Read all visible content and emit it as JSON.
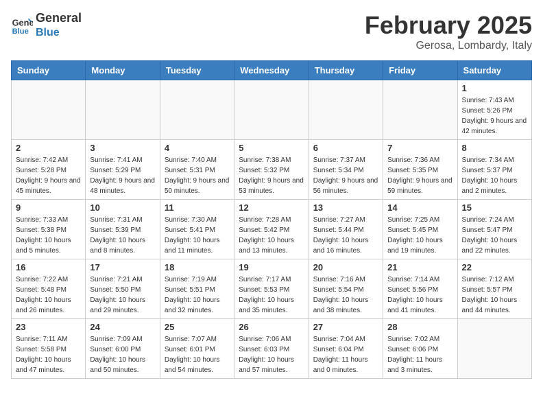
{
  "logo": {
    "text_general": "General",
    "text_blue": "Blue"
  },
  "header": {
    "month": "February 2025",
    "location": "Gerosa, Lombardy, Italy"
  },
  "days_of_week": [
    "Sunday",
    "Monday",
    "Tuesday",
    "Wednesday",
    "Thursday",
    "Friday",
    "Saturday"
  ],
  "weeks": [
    [
      {
        "day": "",
        "info": ""
      },
      {
        "day": "",
        "info": ""
      },
      {
        "day": "",
        "info": ""
      },
      {
        "day": "",
        "info": ""
      },
      {
        "day": "",
        "info": ""
      },
      {
        "day": "",
        "info": ""
      },
      {
        "day": "1",
        "info": "Sunrise: 7:43 AM\nSunset: 5:26 PM\nDaylight: 9 hours and 42 minutes."
      }
    ],
    [
      {
        "day": "2",
        "info": "Sunrise: 7:42 AM\nSunset: 5:28 PM\nDaylight: 9 hours and 45 minutes."
      },
      {
        "day": "3",
        "info": "Sunrise: 7:41 AM\nSunset: 5:29 PM\nDaylight: 9 hours and 48 minutes."
      },
      {
        "day": "4",
        "info": "Sunrise: 7:40 AM\nSunset: 5:31 PM\nDaylight: 9 hours and 50 minutes."
      },
      {
        "day": "5",
        "info": "Sunrise: 7:38 AM\nSunset: 5:32 PM\nDaylight: 9 hours and 53 minutes."
      },
      {
        "day": "6",
        "info": "Sunrise: 7:37 AM\nSunset: 5:34 PM\nDaylight: 9 hours and 56 minutes."
      },
      {
        "day": "7",
        "info": "Sunrise: 7:36 AM\nSunset: 5:35 PM\nDaylight: 9 hours and 59 minutes."
      },
      {
        "day": "8",
        "info": "Sunrise: 7:34 AM\nSunset: 5:37 PM\nDaylight: 10 hours and 2 minutes."
      }
    ],
    [
      {
        "day": "9",
        "info": "Sunrise: 7:33 AM\nSunset: 5:38 PM\nDaylight: 10 hours and 5 minutes."
      },
      {
        "day": "10",
        "info": "Sunrise: 7:31 AM\nSunset: 5:39 PM\nDaylight: 10 hours and 8 minutes."
      },
      {
        "day": "11",
        "info": "Sunrise: 7:30 AM\nSunset: 5:41 PM\nDaylight: 10 hours and 11 minutes."
      },
      {
        "day": "12",
        "info": "Sunrise: 7:28 AM\nSunset: 5:42 PM\nDaylight: 10 hours and 13 minutes."
      },
      {
        "day": "13",
        "info": "Sunrise: 7:27 AM\nSunset: 5:44 PM\nDaylight: 10 hours and 16 minutes."
      },
      {
        "day": "14",
        "info": "Sunrise: 7:25 AM\nSunset: 5:45 PM\nDaylight: 10 hours and 19 minutes."
      },
      {
        "day": "15",
        "info": "Sunrise: 7:24 AM\nSunset: 5:47 PM\nDaylight: 10 hours and 22 minutes."
      }
    ],
    [
      {
        "day": "16",
        "info": "Sunrise: 7:22 AM\nSunset: 5:48 PM\nDaylight: 10 hours and 26 minutes."
      },
      {
        "day": "17",
        "info": "Sunrise: 7:21 AM\nSunset: 5:50 PM\nDaylight: 10 hours and 29 minutes."
      },
      {
        "day": "18",
        "info": "Sunrise: 7:19 AM\nSunset: 5:51 PM\nDaylight: 10 hours and 32 minutes."
      },
      {
        "day": "19",
        "info": "Sunrise: 7:17 AM\nSunset: 5:53 PM\nDaylight: 10 hours and 35 minutes."
      },
      {
        "day": "20",
        "info": "Sunrise: 7:16 AM\nSunset: 5:54 PM\nDaylight: 10 hours and 38 minutes."
      },
      {
        "day": "21",
        "info": "Sunrise: 7:14 AM\nSunset: 5:56 PM\nDaylight: 10 hours and 41 minutes."
      },
      {
        "day": "22",
        "info": "Sunrise: 7:12 AM\nSunset: 5:57 PM\nDaylight: 10 hours and 44 minutes."
      }
    ],
    [
      {
        "day": "23",
        "info": "Sunrise: 7:11 AM\nSunset: 5:58 PM\nDaylight: 10 hours and 47 minutes."
      },
      {
        "day": "24",
        "info": "Sunrise: 7:09 AM\nSunset: 6:00 PM\nDaylight: 10 hours and 50 minutes."
      },
      {
        "day": "25",
        "info": "Sunrise: 7:07 AM\nSunset: 6:01 PM\nDaylight: 10 hours and 54 minutes."
      },
      {
        "day": "26",
        "info": "Sunrise: 7:06 AM\nSunset: 6:03 PM\nDaylight: 10 hours and 57 minutes."
      },
      {
        "day": "27",
        "info": "Sunrise: 7:04 AM\nSunset: 6:04 PM\nDaylight: 11 hours and 0 minutes."
      },
      {
        "day": "28",
        "info": "Sunrise: 7:02 AM\nSunset: 6:06 PM\nDaylight: 11 hours and 3 minutes."
      },
      {
        "day": "",
        "info": ""
      }
    ]
  ]
}
